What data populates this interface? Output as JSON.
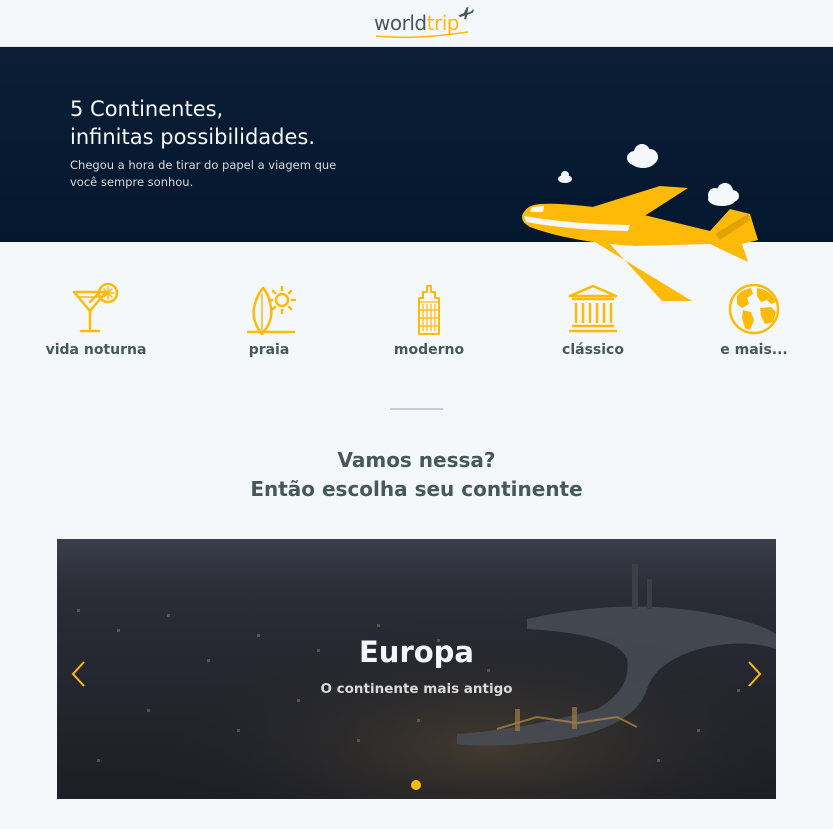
{
  "header": {
    "logo_word": "world",
    "logo_accent": "trip",
    "logo_icon": "airplane-icon"
  },
  "banner": {
    "title_line1": "5 Continentes,",
    "title_line2": "infinitas possibilidades.",
    "subtitle": "Chegou a hora de tirar do papel a viagem que você sempre sonhou.",
    "illustration": "airplane-illustration"
  },
  "travel_types": [
    {
      "label": "vida noturna",
      "icon": "cocktail-icon"
    },
    {
      "label": "praia",
      "icon": "surf-sun-icon"
    },
    {
      "label": "moderno",
      "icon": "building-icon"
    },
    {
      "label": "clássico",
      "icon": "museum-icon"
    },
    {
      "label": "e mais...",
      "icon": "globe-icon"
    }
  ],
  "cta": {
    "line1": "Vamos nessa?",
    "line2": "Então escolha seu continente"
  },
  "slider": {
    "title": "Europa",
    "subtitle": "O continente mais antigo",
    "active_index": 0,
    "total_slides": 1
  },
  "colors": {
    "accent": "#ffba08",
    "text": "#47585b",
    "background": "#f5f8fa",
    "banner": "#03172e"
  }
}
